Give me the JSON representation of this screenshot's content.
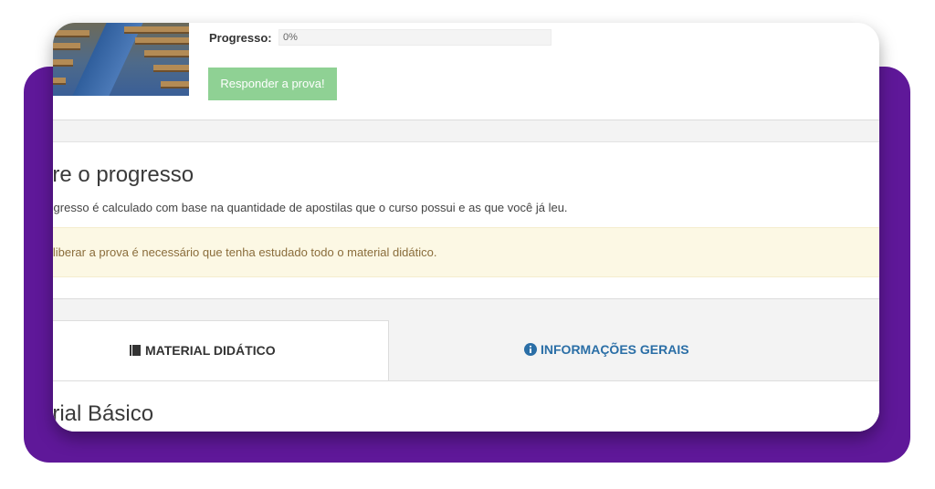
{
  "course": {
    "progress_label": "Progresso:",
    "progress_value": 0,
    "progress_text": "0%",
    "respond_button": "Responder a prova!"
  },
  "about": {
    "title": "bre o progresso",
    "description": "rogresso é calculado com base na quantidade de apostilas que o curso possui e as que você já leu.",
    "alert": "a liberar a prova é necessário que tenha estudado todo o material didático."
  },
  "tabs": [
    {
      "label": "MATERIAL DIDÁTICO",
      "icon": "book-icon",
      "active": true
    },
    {
      "label": "INFORMAÇÕES GERAIS",
      "icon": "info-circle-icon",
      "active": false
    }
  ],
  "content": {
    "section_title": "erial Básico"
  },
  "colors": {
    "frame_purple": "#5f1899",
    "button_green": "#8fd194",
    "alert_bg": "#fcf8e4",
    "tab_link": "#2a6ea6"
  }
}
